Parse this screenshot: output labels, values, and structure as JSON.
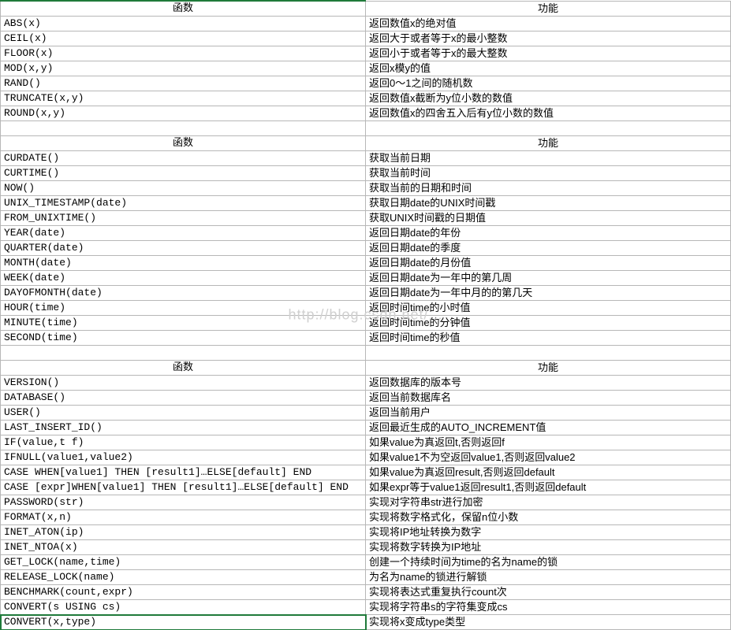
{
  "watermark": "http://blog.csdn.net/...",
  "sections": [
    {
      "header": {
        "left": "函数",
        "right": "功能"
      },
      "rows": [
        {
          "fn": "ABS(x)",
          "desc": "返回数值x的绝对值"
        },
        {
          "fn": "CEIL(x)",
          "desc": "返回大于或者等于x的最小整数"
        },
        {
          "fn": "FLOOR(x)",
          "desc": "返回小于或者等于x的最大整数"
        },
        {
          "fn": "MOD(x,y)",
          "desc": "返回x模y的值"
        },
        {
          "fn": "RAND()",
          "desc": "返回0～1之间的随机数"
        },
        {
          "fn": "TRUNCATE(x,y)",
          "desc": "返回数值x截断为y位小数的数值"
        },
        {
          "fn": "ROUND(x,y)",
          "desc": "返回数值x的四舍五入后有y位小数的数值"
        }
      ]
    },
    {
      "header": {
        "left": "函数",
        "right": "功能"
      },
      "rows": [
        {
          "fn": "CURDATE()",
          "desc": "获取当前日期"
        },
        {
          "fn": "CURTIME()",
          "desc": "获取当前时间"
        },
        {
          "fn": "NOW()",
          "desc": "获取当前的日期和时间"
        },
        {
          "fn": "UNIX_TIMESTAMP(date)",
          "desc": "获取日期date的UNIX时间戳"
        },
        {
          "fn": "FROM_UNIXTIME()",
          "desc": "获取UNIX时间戳的日期值"
        },
        {
          "fn": "YEAR(date)",
          "desc": "返回日期date的年份"
        },
        {
          "fn": "QUARTER(date)",
          "desc": "返回日期date的季度"
        },
        {
          "fn": "MONTH(date)",
          "desc": "返回日期date的月份值"
        },
        {
          "fn": "WEEK(date)",
          "desc": "返回日期date为一年中的第几周"
        },
        {
          "fn": "DAYOFMONTH(date)",
          "desc": "返回日期date为一年中月的的第几天"
        },
        {
          "fn": "HOUR(time)",
          "desc": "返回时间time的小时值"
        },
        {
          "fn": "MINUTE(time)",
          "desc": "返回时间time的分钟值"
        },
        {
          "fn": "SECOND(time)",
          "desc": "返回时间time的秒值"
        }
      ]
    },
    {
      "header": {
        "left": "函数",
        "right": "功能"
      },
      "rows": [
        {
          "fn": "VERSION()",
          "desc": "返回数据库的版本号"
        },
        {
          "fn": "DATABASE()",
          "desc": "返回当前数据库名"
        },
        {
          "fn": "USER()",
          "desc": "返回当前用户"
        },
        {
          "fn": "LAST_INSERT_ID()",
          "desc": "返回最近生成的AUTO_INCREMENT值"
        },
        {
          "fn": "IF(value,t f)",
          "desc": "如果value为真返回t,否则返回f"
        },
        {
          "fn": "IFNULL(value1,value2)",
          "desc": "如果value1不为空返回value1,否则返回value2"
        },
        {
          "fn": "CASE WHEN[value1] THEN [result1]…ELSE[default] END",
          "desc": "如果value为真返回result,否则返回default"
        },
        {
          "fn": "CASE [expr]WHEN[value1] THEN [result1]…ELSE[default] END",
          "desc": "如果expr等于value1返回result1,否则返回default"
        },
        {
          "fn": "PASSWORD(str)",
          "desc": "实现对字符串str进行加密"
        },
        {
          "fn": "FORMAT(x,n)",
          "desc": "实现将数字格式化，保留n位小数"
        },
        {
          "fn": "INET_ATON(ip)",
          "desc": "实现将IP地址转换为数字"
        },
        {
          "fn": "INET_NTOA(x)",
          "desc": "实现将数字转换为IP地址"
        },
        {
          "fn": "GET_LOCK(name,time)",
          "desc": "创建一个持续时间为time的名为name的锁"
        },
        {
          "fn": "RELEASE_LOCK(name)",
          "desc": "为名为name的锁进行解锁"
        },
        {
          "fn": "BENCHMARK(count,expr)",
          "desc": "实现将表达式重复执行count次"
        },
        {
          "fn": "CONVERT(s USING cs)",
          "desc": "实现将字符串s的字符集变成cs"
        },
        {
          "fn": "CONVERT(x,type)",
          "desc": "实现将x变成type类型",
          "active": true
        }
      ]
    }
  ]
}
